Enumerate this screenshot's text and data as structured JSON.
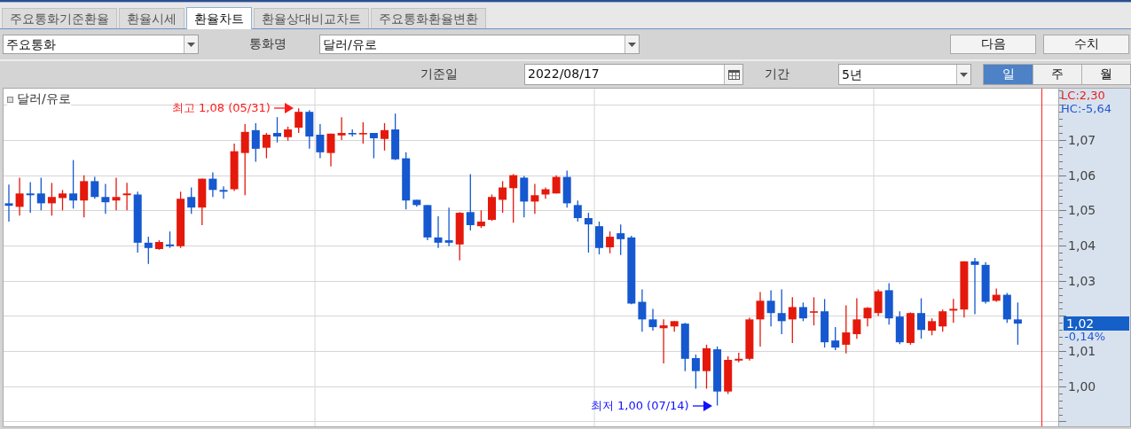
{
  "tabs": [
    {
      "label": "주요통화기준환율",
      "selected": false
    },
    {
      "label": "환율시세",
      "selected": false
    },
    {
      "label": "환율차트",
      "selected": true
    },
    {
      "label": "환율상대비교차트",
      "selected": false
    },
    {
      "label": "주요통화환율변환",
      "selected": false
    }
  ],
  "toolbar": {
    "group_select": {
      "value": "주요통화"
    },
    "currency_label": "통화명",
    "currency_select": {
      "value": "달러/유로"
    },
    "buttons": [
      "다음",
      "수치"
    ]
  },
  "filters": {
    "date_label": "기준일",
    "date_field": {
      "value": "2022/08/17"
    },
    "period_label": "기간",
    "period_select": {
      "value": "5년"
    },
    "intervals": [
      {
        "label": "일",
        "selected": true
      },
      {
        "label": "주",
        "selected": false
      },
      {
        "label": "월",
        "selected": false
      }
    ]
  },
  "chart": {
    "legend": "달러/유로",
    "lc": "LC:2,30",
    "hc": "HC:-5,64",
    "current_price": "1,02",
    "change": "-0,14%",
    "chart_data": {
      "type": "candlestick",
      "grid": true,
      "ylim": [
        0.9886,
        1.0846
      ],
      "yticks": [
        {
          "value": 1.07,
          "label": "1,07"
        },
        {
          "value": 1.06,
          "label": "1,06"
        },
        {
          "value": 1.05,
          "label": "1,05"
        },
        {
          "value": 1.04,
          "label": "1,04"
        },
        {
          "value": 1.03,
          "label": "1,03"
        },
        {
          "value": 1.01,
          "label": "1,01"
        },
        {
          "value": 1.0,
          "label": "1,00"
        }
      ],
      "ohlc": [
        [
          1.052,
          1.0573,
          1.0468,
          1.0513
        ],
        [
          1.051,
          1.0593,
          1.0485,
          1.0548
        ],
        [
          1.0548,
          1.058,
          1.0493,
          1.0543
        ],
        [
          1.0548,
          1.0593,
          1.05,
          1.052
        ],
        [
          1.052,
          1.0578,
          1.0485,
          1.0538
        ],
        [
          1.0535,
          1.0558,
          1.05,
          1.0548
        ],
        [
          1.0548,
          1.0643,
          1.0505,
          1.0528
        ],
        [
          1.0528,
          1.06,
          1.048,
          1.0583
        ],
        [
          1.0583,
          1.0595,
          1.0533,
          1.0538
        ],
        [
          1.0538,
          1.0575,
          1.049,
          1.0523
        ],
        [
          1.0528,
          1.0593,
          1.05,
          1.0538
        ],
        [
          1.0543,
          1.0578,
          1.05,
          1.0548
        ],
        [
          1.0545,
          1.0553,
          1.038,
          1.0408
        ],
        [
          1.0408,
          1.0425,
          1.0348,
          1.0393
        ],
        [
          1.039,
          1.0415,
          1.0388,
          1.041
        ],
        [
          1.0403,
          1.044,
          1.0393,
          1.0398
        ],
        [
          1.0398,
          1.0553,
          1.0393,
          1.0533
        ],
        [
          1.0538,
          1.0565,
          1.049,
          1.0508
        ],
        [
          1.0508,
          1.059,
          1.0458,
          1.059
        ],
        [
          1.059,
          1.0608,
          1.0538,
          1.0558
        ],
        [
          1.0558,
          1.0568,
          1.0533,
          1.0553
        ],
        [
          1.056,
          1.069,
          1.0555,
          1.0668
        ],
        [
          1.0663,
          1.0745,
          1.0543,
          1.0723
        ],
        [
          1.0728,
          1.0748,
          1.0638,
          1.0675
        ],
        [
          1.0678,
          1.072,
          1.0648,
          1.0715
        ],
        [
          1.072,
          1.0765,
          1.0693,
          1.071
        ],
        [
          1.0708,
          1.0738,
          1.0698,
          1.073
        ],
        [
          1.0735,
          1.079,
          1.072,
          1.078
        ],
        [
          1.078,
          1.0785,
          1.0675,
          1.071
        ],
        [
          1.0715,
          1.0745,
          1.0648,
          1.0665
        ],
        [
          1.0663,
          1.0718,
          1.0625,
          1.0718
        ],
        [
          1.0713,
          1.0765,
          1.07,
          1.072
        ],
        [
          1.072,
          1.073,
          1.071,
          1.0718
        ],
        [
          1.0718,
          1.075,
          1.069,
          1.072
        ],
        [
          1.072,
          1.072,
          1.0648,
          1.0705
        ],
        [
          1.0703,
          1.0748,
          1.067,
          1.0728
        ],
        [
          1.073,
          1.0775,
          1.0643,
          1.0645
        ],
        [
          1.0648,
          1.0665,
          1.0503,
          1.0528
        ],
        [
          1.053,
          1.053,
          1.051,
          1.0515
        ],
        [
          1.0515,
          1.0515,
          1.0415,
          1.0423
        ],
        [
          1.0423,
          1.0483,
          1.0393,
          1.0408
        ],
        [
          1.0415,
          1.0508,
          1.0398,
          1.0408
        ],
        [
          1.0403,
          1.0495,
          1.0358,
          1.0493
        ],
        [
          1.0495,
          1.0603,
          1.0443,
          1.0458
        ],
        [
          1.0455,
          1.05,
          1.045,
          1.0468
        ],
        [
          1.0473,
          1.0545,
          1.047,
          1.0538
        ],
        [
          1.053,
          1.0583,
          1.0493,
          1.0565
        ],
        [
          1.0563,
          1.0603,
          1.0465,
          1.06
        ],
        [
          1.0593,
          1.0598,
          1.048,
          1.0525
        ],
        [
          1.0525,
          1.0575,
          1.049,
          1.0543
        ],
        [
          1.0545,
          1.0565,
          1.0533,
          1.056
        ],
        [
          1.0548,
          1.06,
          1.0548,
          1.0595
        ],
        [
          1.0595,
          1.0613,
          1.0508,
          1.052
        ],
        [
          1.0515,
          1.0528,
          1.0468,
          1.0478
        ],
        [
          1.0478,
          1.0493,
          1.038,
          1.046
        ],
        [
          1.0455,
          1.0468,
          1.0375,
          1.0393
        ],
        [
          1.0395,
          1.044,
          1.0378,
          1.0425
        ],
        [
          1.0435,
          1.046,
          1.0373,
          1.0418
        ],
        [
          1.0423,
          1.0428,
          1.0233,
          1.0235
        ],
        [
          1.024,
          1.0275,
          1.0155,
          1.019
        ],
        [
          1.019,
          1.022,
          1.0158,
          1.0168
        ],
        [
          1.0165,
          1.019,
          1.0065,
          1.0173
        ],
        [
          1.017,
          1.0185,
          1.0155,
          1.0185
        ],
        [
          1.0178,
          1.018,
          1.0043,
          1.0078
        ],
        [
          1.008,
          1.009,
          0.9993,
          1.0043
        ],
        [
          1.0043,
          1.0118,
          0.9993,
          1.0108
        ],
        [
          1.0105,
          1.0113,
          0.9945,
          0.9985
        ],
        [
          0.9985,
          1.0085,
          0.9978,
          1.0075
        ],
        [
          1.0073,
          1.0095,
          1.0068,
          1.0078
        ],
        [
          1.0078,
          1.0195,
          1.0073,
          1.019
        ],
        [
          1.019,
          1.0268,
          1.0113,
          1.0243
        ],
        [
          1.0243,
          1.0273,
          1.017,
          1.0208
        ],
        [
          1.0208,
          1.0275,
          1.0148,
          1.0185
        ],
        [
          1.019,
          1.0253,
          1.0123,
          1.0225
        ],
        [
          1.0225,
          1.0238,
          1.0185,
          1.0193
        ],
        [
          1.021,
          1.0253,
          1.0173,
          1.0213
        ],
        [
          1.0213,
          1.0248,
          1.011,
          1.0125
        ],
        [
          1.013,
          1.0168,
          1.0103,
          1.011
        ],
        [
          1.0118,
          1.023,
          1.0093,
          1.0153
        ],
        [
          1.0148,
          1.025,
          1.0135,
          1.019
        ],
        [
          1.0193,
          1.0225,
          1.017,
          1.0223
        ],
        [
          1.0208,
          1.0275,
          1.02,
          1.027
        ],
        [
          1.0273,
          1.0293,
          1.0175,
          1.0193
        ],
        [
          1.0198,
          1.0213,
          1.012,
          1.0125
        ],
        [
          1.0123,
          1.021,
          1.0118,
          1.0208
        ],
        [
          1.0208,
          1.025,
          1.0135,
          1.016
        ],
        [
          1.0158,
          1.0193,
          1.0145,
          1.0185
        ],
        [
          1.017,
          1.0218,
          1.0155,
          1.0213
        ],
        [
          1.0215,
          1.0248,
          1.018,
          1.022
        ],
        [
          1.0218,
          1.0355,
          1.0195,
          1.0355
        ],
        [
          1.0355,
          1.0365,
          1.0205,
          1.0345
        ],
        [
          1.0345,
          1.0353,
          1.0235,
          1.024
        ],
        [
          1.0243,
          1.0278,
          1.024,
          1.026
        ],
        [
          1.026,
          1.0265,
          1.018,
          1.019
        ],
        [
          1.019,
          1.0238,
          1.0118,
          1.0178
        ]
      ],
      "annotations": [
        "최고 1,08 (05/31)",
        "최저 1,00 (07/14)"
      ]
    }
  }
}
